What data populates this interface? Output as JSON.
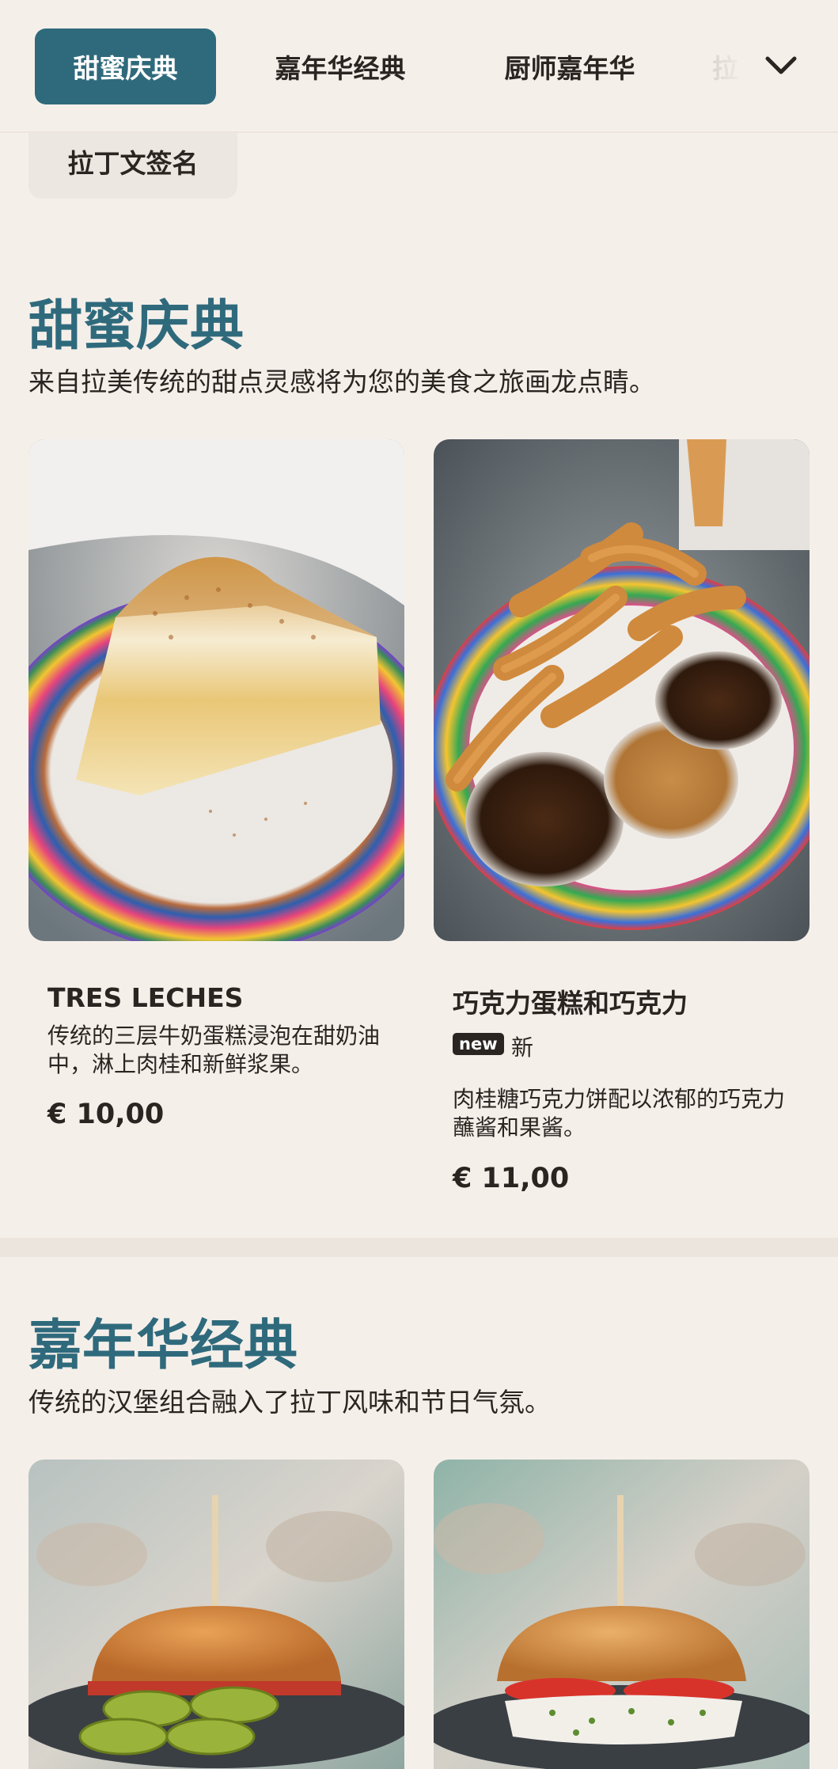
{
  "tabs": {
    "items": [
      "甜蜜庆典",
      "嘉年华经典",
      "厨师嘉年华",
      "拉",
      "拉丁文签名"
    ],
    "active_index": 0
  },
  "sections": [
    {
      "title": "甜蜜庆典",
      "description": "来自拉美传统的甜点灵感将为您的美食之旅画龙点睛。",
      "items": [
        {
          "name": "TRES LECHES",
          "description": "传统的三层牛奶蛋糕浸泡在甜奶油中，淋上肉桂和新鲜浆果。",
          "price": "€ 10,00",
          "image": "tres-leches-photo"
        },
        {
          "name": "巧克力蛋糕和巧克力",
          "badge": "new",
          "badge_label": "新",
          "description": "肉桂糖巧克力饼配以浓郁的巧克力蘸酱和果酱。",
          "price": "€ 11,00",
          "image": "churros-photo"
        }
      ]
    },
    {
      "title": "嘉年华经典",
      "description": "传统的汉堡组合融入了拉丁风味和节日气氛。",
      "items": [
        {
          "image": "burger-pickles-photo"
        },
        {
          "image": "burger-tomato-photo"
        }
      ]
    }
  ],
  "colors": {
    "accent": "#2f6a7c",
    "background": "#f5efea",
    "text": "#2b2522"
  }
}
